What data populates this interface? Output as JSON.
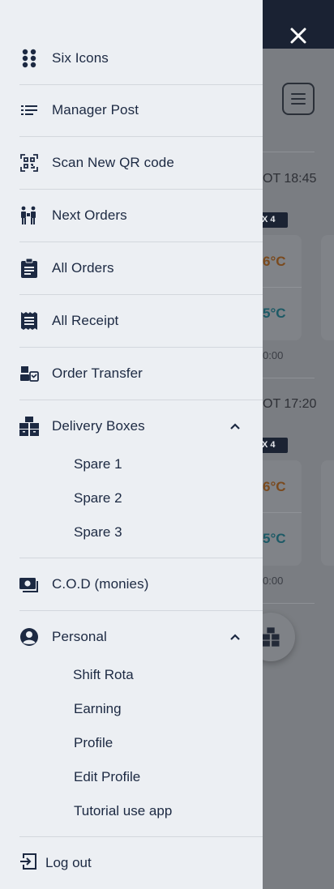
{
  "background": {
    "order_1": {
      "time": "OT 18:45",
      "badge": "X 4",
      "temp_top": "6°C",
      "temp_bottom": "5°C",
      "time_small": "0:00"
    },
    "order_2": {
      "time": "OT 17:20",
      "badge": "X 4",
      "temp_top": "6°C",
      "temp_bottom": "5°C",
      "time_small": "0:00"
    }
  },
  "drawer": {
    "items": [
      {
        "label": "Six Icons",
        "icon": "grid-dots-icon"
      },
      {
        "label": "Manager Post",
        "icon": "list-icon"
      },
      {
        "label": "Scan New QR code",
        "icon": "qr-scan-icon"
      },
      {
        "label": "Next Orders",
        "icon": "delivery-person-icon"
      },
      {
        "label": "All Orders",
        "icon": "clipboard-icon"
      },
      {
        "label": "All Receipt",
        "icon": "receipt-icon"
      },
      {
        "label": "Order Transfer",
        "icon": "transfer-icon"
      },
      {
        "label": "Delivery Boxes",
        "icon": "boxes-icon"
      },
      {
        "label": "C.O.D (monies)",
        "icon": "money-icon"
      },
      {
        "label": "Personal",
        "icon": "account-circle-icon"
      }
    ],
    "delivery_boxes_sub": [
      "Spare 1",
      "Spare 2",
      "Spare 3"
    ],
    "personal_sub": [
      "Shift Rota",
      "Earning",
      "Profile",
      "Edit Profile",
      "Tutorial use app"
    ],
    "logout_label": "Log out"
  },
  "colors": {
    "drawer_bg": "#eceff3",
    "text": "#1c2942",
    "topbar": "#1a2233",
    "scrim": "#7a7d82"
  }
}
